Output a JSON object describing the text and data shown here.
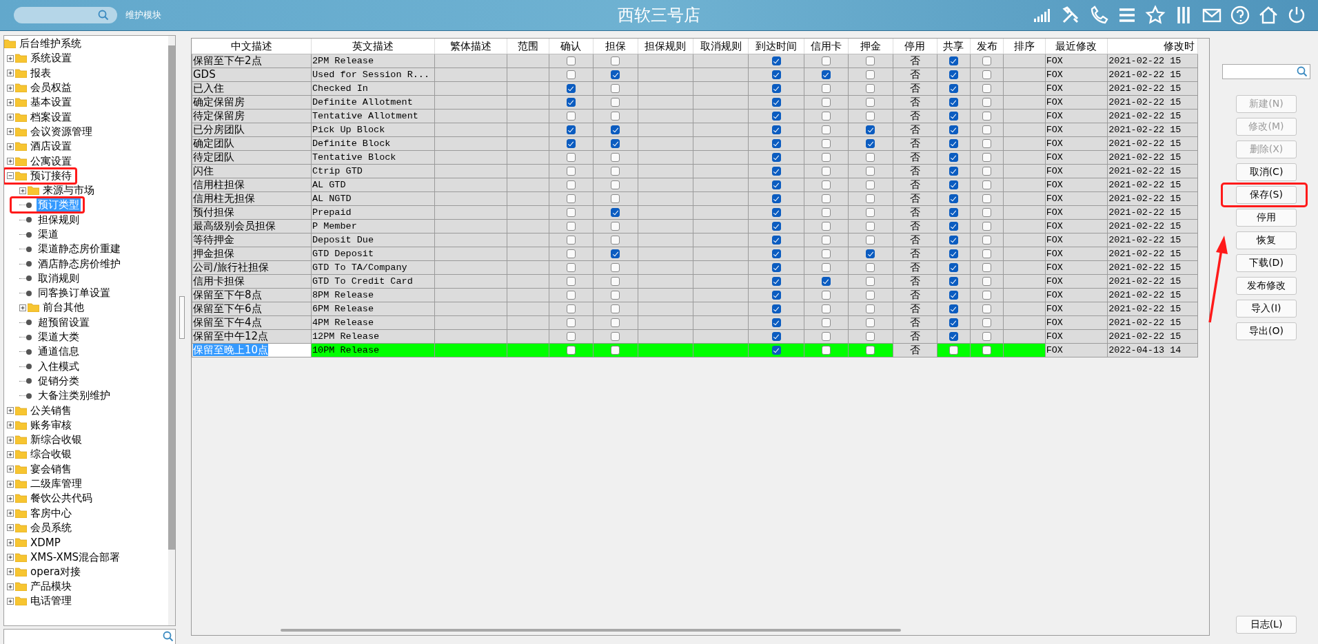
{
  "header": {
    "module_label": "维护模块",
    "title": "西软三号店"
  },
  "tree": {
    "label": "后台维护系统",
    "children": [
      {
        "label": "系统设置",
        "kind": "folder",
        "expanded": false,
        "selected": false,
        "highlighted": false
      },
      {
        "label": "报表",
        "kind": "folder",
        "expanded": false,
        "selected": false,
        "highlighted": false
      },
      {
        "label": "会员权益",
        "kind": "folder",
        "expanded": false,
        "selected": false,
        "highlighted": false
      },
      {
        "label": "基本设置",
        "kind": "folder",
        "expanded": false,
        "selected": false,
        "highlighted": false
      },
      {
        "label": "档案设置",
        "kind": "folder",
        "expanded": false,
        "selected": false,
        "highlighted": false
      },
      {
        "label": "会议资源管理",
        "kind": "folder",
        "expanded": false,
        "selected": false,
        "highlighted": false
      },
      {
        "label": "酒店设置",
        "kind": "folder",
        "expanded": false,
        "selected": false,
        "highlighted": false
      },
      {
        "label": "公寓设置",
        "kind": "folder",
        "expanded": false,
        "selected": false,
        "highlighted": false
      },
      {
        "label": "预订接待",
        "kind": "folder",
        "expanded": true,
        "selected": false,
        "highlighted": true,
        "children": [
          {
            "label": "来源与市场",
            "kind": "folder",
            "expanded": false,
            "selected": false,
            "highlighted": false
          },
          {
            "label": "预订类型",
            "kind": "leaf",
            "selected": true,
            "highlighted": true
          },
          {
            "label": "担保规则",
            "kind": "leaf",
            "selected": false,
            "highlighted": false
          },
          {
            "label": "渠道",
            "kind": "leaf",
            "selected": false,
            "highlighted": false
          },
          {
            "label": "渠道静态房价重建",
            "kind": "leaf",
            "selected": false,
            "highlighted": false
          },
          {
            "label": "酒店静态房价维护",
            "kind": "leaf",
            "selected": false,
            "highlighted": false
          },
          {
            "label": "取消规则",
            "kind": "leaf",
            "selected": false,
            "highlighted": false
          },
          {
            "label": "同客换订单设置",
            "kind": "leaf",
            "selected": false,
            "highlighted": false
          },
          {
            "label": "前台其他",
            "kind": "folder",
            "expanded": false,
            "selected": false,
            "highlighted": false
          },
          {
            "label": "超预留设置",
            "kind": "leaf",
            "selected": false,
            "highlighted": false
          },
          {
            "label": "渠道大类",
            "kind": "leaf",
            "selected": false,
            "highlighted": false
          },
          {
            "label": "通道信息",
            "kind": "leaf",
            "selected": false,
            "highlighted": false
          },
          {
            "label": "入住模式",
            "kind": "leaf",
            "selected": false,
            "highlighted": false
          },
          {
            "label": "促销分类",
            "kind": "leaf",
            "selected": false,
            "highlighted": false
          },
          {
            "label": "大备注类别维护",
            "kind": "leaf",
            "selected": false,
            "highlighted": false
          }
        ]
      },
      {
        "label": "公关销售",
        "kind": "folder",
        "expanded": false,
        "selected": false,
        "highlighted": false
      },
      {
        "label": "账务审核",
        "kind": "folder",
        "expanded": false,
        "selected": false,
        "highlighted": false
      },
      {
        "label": "新综合收银",
        "kind": "folder",
        "expanded": false,
        "selected": false,
        "highlighted": false
      },
      {
        "label": "综合收银",
        "kind": "folder",
        "expanded": false,
        "selected": false,
        "highlighted": false
      },
      {
        "label": "宴会销售",
        "kind": "folder",
        "expanded": false,
        "selected": false,
        "highlighted": false
      },
      {
        "label": "二级库管理",
        "kind": "folder",
        "expanded": false,
        "selected": false,
        "highlighted": false
      },
      {
        "label": "餐饮公共代码",
        "kind": "folder",
        "expanded": false,
        "selected": false,
        "highlighted": false
      },
      {
        "label": "客房中心",
        "kind": "folder",
        "expanded": false,
        "selected": false,
        "highlighted": false
      },
      {
        "label": "会员系统",
        "kind": "folder",
        "expanded": false,
        "selected": false,
        "highlighted": false
      },
      {
        "label": "XDMP",
        "kind": "folder",
        "expanded": false,
        "selected": false,
        "highlighted": false
      },
      {
        "label": "XMS-XMS混合部署",
        "kind": "folder",
        "expanded": false,
        "selected": false,
        "highlighted": false
      },
      {
        "label": "opera对接",
        "kind": "folder",
        "expanded": false,
        "selected": false,
        "highlighted": false
      },
      {
        "label": "产品模块",
        "kind": "folder",
        "expanded": false,
        "selected": false,
        "highlighted": false
      },
      {
        "label": "电话管理",
        "kind": "folder",
        "expanded": false,
        "selected": false,
        "highlighted": false
      }
    ]
  },
  "table": {
    "columns": [
      "中文描述",
      "英文描述",
      "繁体描述",
      "范围",
      "确认",
      "担保",
      "担保规则",
      "取消规则",
      "到达时间",
      "信用卡",
      "押金",
      "停用",
      "共享",
      "发布",
      "排序",
      "最近修改",
      "修改时"
    ],
    "rows": [
      {
        "chinese": "保留至下午2点",
        "english": "2PM Release",
        "confirm": false,
        "guarantee": false,
        "arrival_time": true,
        "credit_card": false,
        "deposit": false,
        "disabled": "否",
        "shared": true,
        "published": false,
        "modified_by": "FOX",
        "modified_time": "2021-02-22 15",
        "selected": false,
        "editing": false
      },
      {
        "chinese": "GDS",
        "english": "Used for Session R...",
        "confirm": false,
        "guarantee": true,
        "arrival_time": true,
        "credit_card": true,
        "deposit": false,
        "disabled": "否",
        "shared": true,
        "published": false,
        "modified_by": "FOX",
        "modified_time": "2021-02-22 15",
        "selected": false,
        "editing": false
      },
      {
        "chinese": "已入住",
        "english": "Checked In",
        "confirm": true,
        "guarantee": false,
        "arrival_time": true,
        "credit_card": false,
        "deposit": false,
        "disabled": "否",
        "shared": true,
        "published": false,
        "modified_by": "FOX",
        "modified_time": "2021-02-22 15",
        "selected": false,
        "editing": false
      },
      {
        "chinese": "确定保留房",
        "english": "Definite Allotment",
        "confirm": true,
        "guarantee": false,
        "arrival_time": true,
        "credit_card": false,
        "deposit": false,
        "disabled": "否",
        "shared": true,
        "published": false,
        "modified_by": "FOX",
        "modified_time": "2021-02-22 15",
        "selected": false,
        "editing": false
      },
      {
        "chinese": "待定保留房",
        "english": "Tentative Allotment",
        "confirm": false,
        "guarantee": false,
        "arrival_time": true,
        "credit_card": false,
        "deposit": false,
        "disabled": "否",
        "shared": true,
        "published": false,
        "modified_by": "FOX",
        "modified_time": "2021-02-22 15",
        "selected": false,
        "editing": false
      },
      {
        "chinese": "已分房团队",
        "english": "Pick Up Block",
        "confirm": true,
        "guarantee": true,
        "arrival_time": true,
        "credit_card": false,
        "deposit": true,
        "disabled": "否",
        "shared": true,
        "published": false,
        "modified_by": "FOX",
        "modified_time": "2021-02-22 15",
        "selected": false,
        "editing": false
      },
      {
        "chinese": "确定团队",
        "english": "Definite Block",
        "confirm": true,
        "guarantee": true,
        "arrival_time": true,
        "credit_card": false,
        "deposit": true,
        "disabled": "否",
        "shared": true,
        "published": false,
        "modified_by": "FOX",
        "modified_time": "2021-02-22 15",
        "selected": false,
        "editing": false
      },
      {
        "chinese": "待定团队",
        "english": "Tentative Block",
        "confirm": false,
        "guarantee": false,
        "arrival_time": true,
        "credit_card": false,
        "deposit": false,
        "disabled": "否",
        "shared": true,
        "published": false,
        "modified_by": "FOX",
        "modified_time": "2021-02-22 15",
        "selected": false,
        "editing": false
      },
      {
        "chinese": "闪住",
        "english": "Ctrip GTD",
        "confirm": false,
        "guarantee": false,
        "arrival_time": true,
        "credit_card": false,
        "deposit": false,
        "disabled": "否",
        "shared": true,
        "published": false,
        "modified_by": "FOX",
        "modified_time": "2021-02-22 15",
        "selected": false,
        "editing": false
      },
      {
        "chinese": "信用柱担保",
        "english": "AL GTD",
        "confirm": false,
        "guarantee": false,
        "arrival_time": true,
        "credit_card": false,
        "deposit": false,
        "disabled": "否",
        "shared": true,
        "published": false,
        "modified_by": "FOX",
        "modified_time": "2021-02-22 15",
        "selected": false,
        "editing": false
      },
      {
        "chinese": "信用柱无担保",
        "english": "AL NGTD",
        "confirm": false,
        "guarantee": false,
        "arrival_time": true,
        "credit_card": false,
        "deposit": false,
        "disabled": "否",
        "shared": true,
        "published": false,
        "modified_by": "FOX",
        "modified_time": "2021-02-22 15",
        "selected": false,
        "editing": false
      },
      {
        "chinese": "预付担保",
        "english": "Prepaid",
        "confirm": false,
        "guarantee": true,
        "arrival_time": true,
        "credit_card": false,
        "deposit": false,
        "disabled": "否",
        "shared": true,
        "published": false,
        "modified_by": "FOX",
        "modified_time": "2021-02-22 15",
        "selected": false,
        "editing": false
      },
      {
        "chinese": "最高级别会员担保",
        "english": "P Member",
        "confirm": false,
        "guarantee": false,
        "arrival_time": true,
        "credit_card": false,
        "deposit": false,
        "disabled": "否",
        "shared": true,
        "published": false,
        "modified_by": "FOX",
        "modified_time": "2021-02-22 15",
        "selected": false,
        "editing": false
      },
      {
        "chinese": "等待押金",
        "english": "Deposit Due",
        "confirm": false,
        "guarantee": false,
        "arrival_time": true,
        "credit_card": false,
        "deposit": false,
        "disabled": "否",
        "shared": true,
        "published": false,
        "modified_by": "FOX",
        "modified_time": "2021-02-22 15",
        "selected": false,
        "editing": false
      },
      {
        "chinese": "押金担保",
        "english": "GTD Deposit",
        "confirm": false,
        "guarantee": true,
        "arrival_time": true,
        "credit_card": false,
        "deposit": true,
        "disabled": "否",
        "shared": true,
        "published": false,
        "modified_by": "FOX",
        "modified_time": "2021-02-22 15",
        "selected": false,
        "editing": false
      },
      {
        "chinese": "公司/旅行社担保",
        "english": "GTD To TA/Company",
        "confirm": false,
        "guarantee": false,
        "arrival_time": true,
        "credit_card": false,
        "deposit": false,
        "disabled": "否",
        "shared": true,
        "published": false,
        "modified_by": "FOX",
        "modified_time": "2021-02-22 15",
        "selected": false,
        "editing": false
      },
      {
        "chinese": "信用卡担保",
        "english": "GTD To Credit Card",
        "confirm": false,
        "guarantee": false,
        "arrival_time": true,
        "credit_card": true,
        "deposit": false,
        "disabled": "否",
        "shared": true,
        "published": false,
        "modified_by": "FOX",
        "modified_time": "2021-02-22 15",
        "selected": false,
        "editing": false
      },
      {
        "chinese": "保留至下午8点",
        "english": "8PM Release",
        "confirm": false,
        "guarantee": false,
        "arrival_time": true,
        "credit_card": false,
        "deposit": false,
        "disabled": "否",
        "shared": true,
        "published": false,
        "modified_by": "FOX",
        "modified_time": "2021-02-22 15",
        "selected": false,
        "editing": false
      },
      {
        "chinese": "保留至下午6点",
        "english": "6PM Release",
        "confirm": false,
        "guarantee": false,
        "arrival_time": true,
        "credit_card": false,
        "deposit": false,
        "disabled": "否",
        "shared": true,
        "published": false,
        "modified_by": "FOX",
        "modified_time": "2021-02-22 15",
        "selected": false,
        "editing": false
      },
      {
        "chinese": "保留至下午4点",
        "english": "4PM Release",
        "confirm": false,
        "guarantee": false,
        "arrival_time": true,
        "credit_card": false,
        "deposit": false,
        "disabled": "否",
        "shared": true,
        "published": false,
        "modified_by": "FOX",
        "modified_time": "2021-02-22 15",
        "selected": false,
        "editing": false
      },
      {
        "chinese": "保留至中午12点",
        "english": "12PM Release",
        "confirm": false,
        "guarantee": false,
        "arrival_time": true,
        "credit_card": false,
        "deposit": false,
        "disabled": "否",
        "shared": true,
        "published": false,
        "modified_by": "FOX",
        "modified_time": "2021-02-22 15",
        "selected": false,
        "editing": false
      },
      {
        "chinese": "保留至晚上10点",
        "english": "10PM Release",
        "confirm": false,
        "guarantee": false,
        "arrival_time": true,
        "credit_card": false,
        "deposit": false,
        "disabled": "否",
        "shared": false,
        "published": false,
        "modified_by": "FOX",
        "modified_time": "2022-04-13 14",
        "selected": true,
        "editing": true
      }
    ]
  },
  "actions": [
    {
      "label": "新建(N)",
      "disabled": true,
      "highlighted": false
    },
    {
      "label": "修改(M)",
      "disabled": true,
      "highlighted": false
    },
    {
      "label": "删除(X)",
      "disabled": true,
      "highlighted": false
    },
    {
      "label": "取消(C)",
      "disabled": false,
      "highlighted": false
    },
    {
      "label": "保存(S)",
      "disabled": false,
      "highlighted": true
    },
    {
      "label": "停用",
      "disabled": false,
      "highlighted": false
    },
    {
      "label": "恢复",
      "disabled": false,
      "highlighted": false
    },
    {
      "label": "下载(D)",
      "disabled": false,
      "highlighted": false
    },
    {
      "label": "发布修改",
      "disabled": false,
      "highlighted": false
    },
    {
      "label": "导入(I)",
      "disabled": false,
      "highlighted": false
    },
    {
      "label": "导出(O)",
      "disabled": false,
      "highlighted": false
    }
  ],
  "log_button": {
    "label": "日志(L)"
  },
  "pointer_arrow": true
}
